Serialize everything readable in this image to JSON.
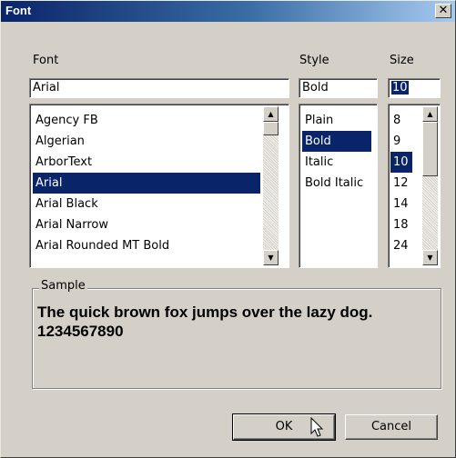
{
  "window": {
    "title": "Font",
    "close_glyph": "✕"
  },
  "font": {
    "label": "Font",
    "value": "Arial",
    "items": [
      "Agency FB",
      "Algerian",
      "ArborText",
      "Arial",
      "Arial Black",
      "Arial Narrow",
      "Arial Rounded MT Bold"
    ],
    "selected": "Arial"
  },
  "style": {
    "label": "Style",
    "value": "Bold",
    "items": [
      "Plain",
      "Bold",
      "Italic",
      "Bold Italic"
    ],
    "selected": "Bold"
  },
  "size": {
    "label": "Size",
    "value": "10",
    "items": [
      "8",
      "9",
      "10",
      "12",
      "14",
      "18",
      "24"
    ],
    "selected": "10"
  },
  "sample": {
    "legend": "Sample",
    "line1": "The quick brown fox jumps over the lazy dog.",
    "line2": "1234567890"
  },
  "buttons": {
    "ok": "OK",
    "cancel": "Cancel"
  },
  "icons": {
    "scroll_up": "▲",
    "scroll_down": "▼",
    "cursor": "mouse-pointer-icon"
  },
  "colors": {
    "selection": "#0a246a",
    "dialog_face": "#d4d0c8"
  }
}
